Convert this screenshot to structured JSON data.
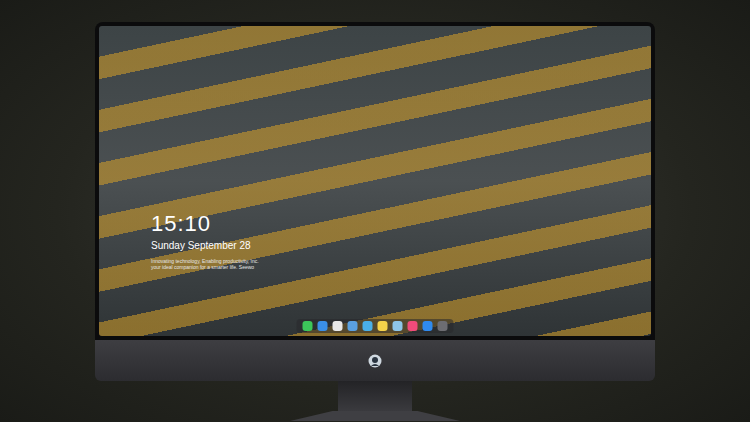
{
  "lock_screen": {
    "time": "15:10",
    "date": "Sunday September 28",
    "tagline": [
      "Innovating technology, Enabling productivity, Inc.",
      "your ideal companion for a smarter life. Seewo"
    ]
  },
  "dock": {
    "items": [
      {
        "name": "messages",
        "color": "#3cc65a"
      },
      {
        "name": "finder",
        "color": "#3a8ee6"
      },
      {
        "name": "clock",
        "color": "#e8e8e8"
      },
      {
        "name": "files",
        "color": "#5aa0e0"
      },
      {
        "name": "video",
        "color": "#4ab0e8"
      },
      {
        "name": "notes",
        "color": "#f5d34a"
      },
      {
        "name": "photos",
        "color": "#8ec6e8"
      },
      {
        "name": "music",
        "color": "#f04b7a"
      },
      {
        "name": "store",
        "color": "#2f8bf0"
      },
      {
        "name": "camera",
        "color": "#6d6d72"
      }
    ]
  }
}
